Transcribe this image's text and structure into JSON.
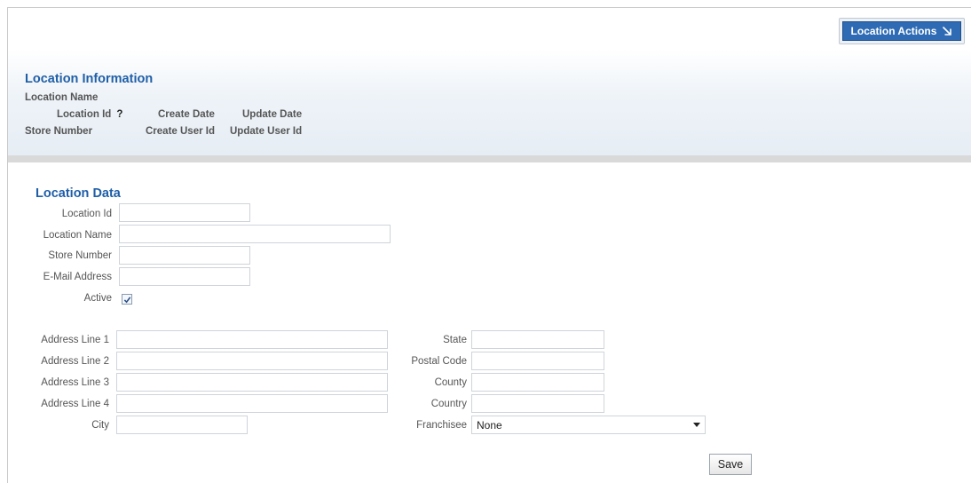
{
  "header": {
    "actions_button": "Location Actions",
    "title": "Location Information",
    "location_name_label": "Location Name",
    "location_id_label": "Location Id",
    "help_glyph": "?",
    "create_date_label": "Create Date",
    "update_date_label": "Update Date",
    "store_number_label": "Store Number",
    "create_user_label": "Create User Id",
    "update_user_label": "Update User Id"
  },
  "form": {
    "title": "Location Data",
    "location_id": {
      "label": "Location Id",
      "value": ""
    },
    "location_name": {
      "label": "Location Name",
      "value": ""
    },
    "store_number": {
      "label": "Store Number",
      "value": ""
    },
    "email": {
      "label": "E-Mail Address",
      "value": ""
    },
    "active": {
      "label": "Active",
      "checked": true
    },
    "address1": {
      "label": "Address Line 1",
      "value": ""
    },
    "address2": {
      "label": "Address Line 2",
      "value": ""
    },
    "address3": {
      "label": "Address Line 3",
      "value": ""
    },
    "address4": {
      "label": "Address Line 4",
      "value": ""
    },
    "city": {
      "label": "City",
      "value": ""
    },
    "state": {
      "label": "State",
      "value": ""
    },
    "postal_code": {
      "label": "Postal Code",
      "value": ""
    },
    "county": {
      "label": "County",
      "value": ""
    },
    "country": {
      "label": "Country",
      "value": ""
    },
    "franchisee": {
      "label": "Franchisee",
      "selected": "None"
    },
    "save_button": "Save"
  },
  "colors": {
    "accent": "#2e6bb4",
    "title": "#1f5fa8"
  }
}
